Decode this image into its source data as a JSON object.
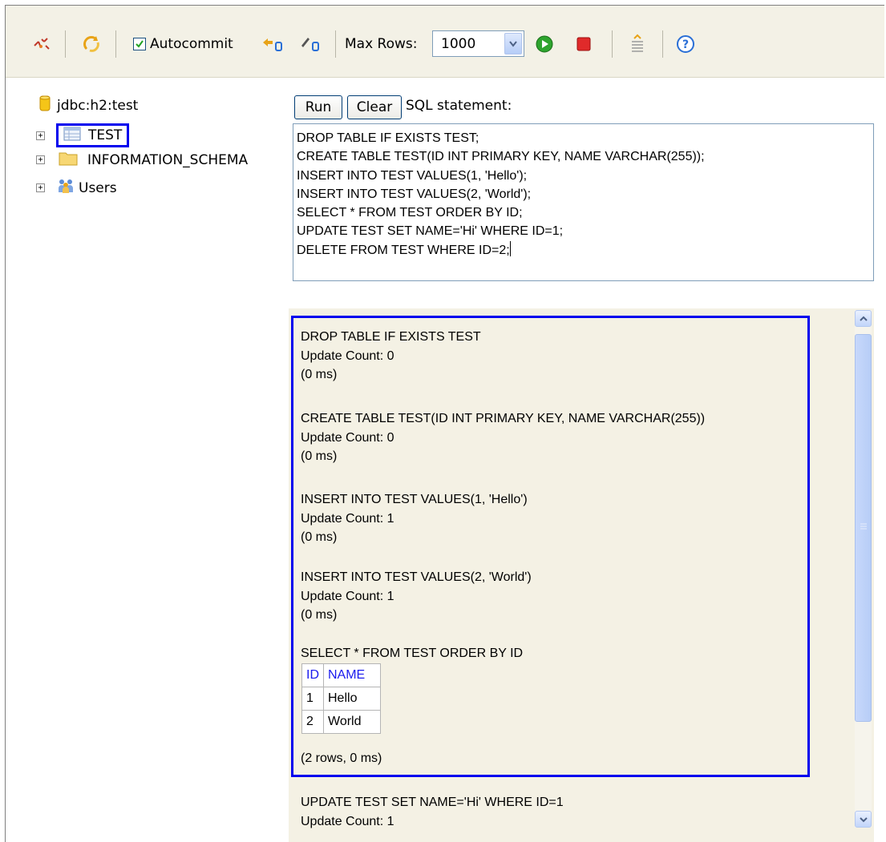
{
  "toolbar": {
    "autocommit_label": "Autocommit",
    "autocommit_checked": true,
    "max_rows_label": "Max Rows:",
    "max_rows_value": "1000",
    "icons": [
      "disconnect-icon",
      "refresh-icon",
      "rollback-icon",
      "commit-icon",
      "run-icon",
      "stop-icon",
      "auto-complete-icon",
      "help-icon"
    ]
  },
  "tree": {
    "connection": "jdbc:h2:test",
    "items": [
      {
        "label": "TEST",
        "icon": "table-icon"
      },
      {
        "label": "INFORMATION_SCHEMA",
        "icon": "folder-icon"
      },
      {
        "label": "Users",
        "icon": "users-icon"
      }
    ]
  },
  "editor": {
    "run_label": "Run",
    "clear_label": "Clear",
    "sql_label": "SQL statement:",
    "sql_lines": [
      "DROP TABLE IF EXISTS TEST;",
      "CREATE TABLE TEST(ID INT PRIMARY KEY, NAME VARCHAR(255));",
      "INSERT INTO TEST VALUES(1, 'Hello');",
      "INSERT INTO TEST VALUES(2, 'World');",
      "SELECT * FROM TEST ORDER BY ID;",
      "UPDATE TEST SET NAME='Hi' WHERE ID=1;",
      "DELETE FROM TEST WHERE ID=2;"
    ]
  },
  "results": {
    "blocks": [
      {
        "statement": "DROP TABLE IF EXISTS TEST",
        "count": "Update Count: 0",
        "time": "(0 ms)"
      },
      {
        "statement": "CREATE TABLE TEST(ID INT PRIMARY KEY, NAME VARCHAR(255))",
        "count": "Update Count: 0",
        "time": "(0 ms)"
      },
      {
        "statement": "INSERT INTO TEST VALUES(1, 'Hello')",
        "count": "Update Count: 1",
        "time": "(0 ms)"
      },
      {
        "statement": "INSERT INTO TEST VALUES(2, 'World')",
        "count": "Update Count: 1",
        "time": "(0 ms)"
      }
    ],
    "select": {
      "statement": "SELECT * FROM TEST ORDER BY ID",
      "columns": [
        "ID",
        "NAME"
      ],
      "rows": [
        [
          "1",
          "Hello"
        ],
        [
          "2",
          "World"
        ]
      ],
      "summary": "(2 rows, 0 ms)"
    },
    "update": {
      "statement": "UPDATE TEST SET NAME='Hi' WHERE ID=1",
      "count": "Update Count: 1"
    }
  },
  "colors": {
    "highlight": "#0000ee",
    "panel_bg": "#f4f1e4",
    "toolbar_bg": "#f3f1e6"
  }
}
